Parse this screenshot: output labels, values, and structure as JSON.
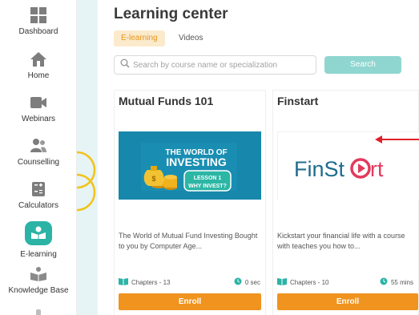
{
  "sidebar": {
    "items": [
      {
        "label": "Dashboard",
        "icon": "dashboard-icon",
        "active": false
      },
      {
        "label": "Home",
        "icon": "home-icon",
        "active": false
      },
      {
        "label": "Webinars",
        "icon": "video-camera-icon",
        "active": false
      },
      {
        "label": "Counselling",
        "icon": "people-icon",
        "active": false
      },
      {
        "label": "Calculators",
        "icon": "calculator-icon",
        "active": false
      },
      {
        "label": "E-learning",
        "icon": "book-icon",
        "active": true
      },
      {
        "label": "Knowledge Base",
        "icon": "reader-icon",
        "active": false
      }
    ]
  },
  "main": {
    "title": "Learning center",
    "tabs": [
      {
        "label": "E-learning",
        "active": true
      },
      {
        "label": "Videos",
        "active": false
      }
    ],
    "search": {
      "placeholder": "Search by course name or specialization",
      "button_label": "Search"
    },
    "courses": [
      {
        "title": "Mutual Funds 101",
        "image": {
          "heading_line1": "THE WORLD OF",
          "heading_line2": "INVESTING",
          "lesson": "LESSON 1",
          "question": "WHY INVEST?"
        },
        "description": "The World of Mutual Fund Investing Bought to you by Computer Age...",
        "chapters": "Chapters - 13",
        "duration": "0 sec",
        "enroll_label": "Enroll"
      },
      {
        "title": "Finstart",
        "image": {
          "logo_part1": "FinSt",
          "logo_part2": "rt"
        },
        "description": "Kickstart your financial life with a course with teaches you how to...",
        "chapters": "Chapters - 10",
        "duration": "55 mins",
        "enroll_label": "Enroll"
      }
    ]
  },
  "colors": {
    "accent_teal": "#2bb3a6",
    "search_button": "#8fd6d0",
    "enroll_orange": "#f0931f",
    "tab_active_text": "#e8951b",
    "annotation_arrow": "#e0202a"
  }
}
